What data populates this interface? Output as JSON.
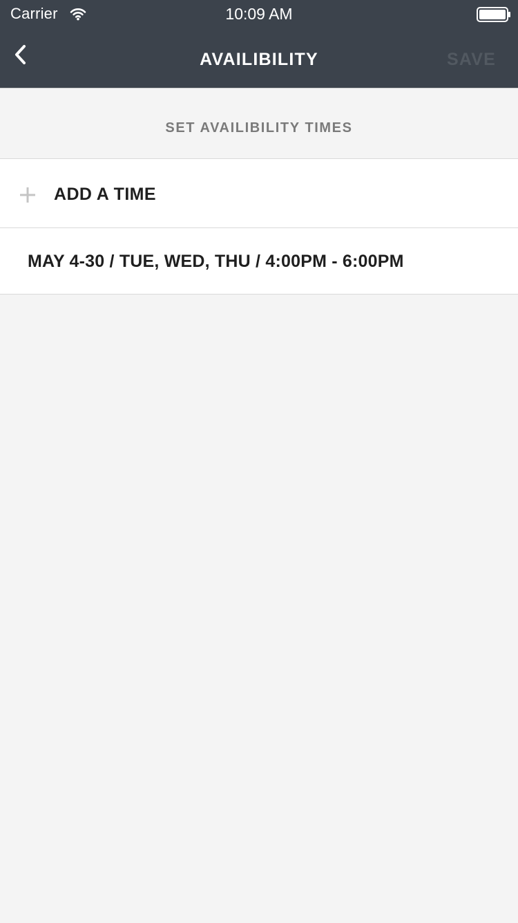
{
  "status_bar": {
    "carrier": "Carrier",
    "time": "10:09 AM",
    "wifi_icon": "wifi-icon",
    "battery_icon": "battery-icon"
  },
  "nav": {
    "back_icon": "chevron-left-icon",
    "title": "AVAILIBILITY",
    "save_label": "SAVE",
    "save_enabled": false
  },
  "section": {
    "title": "SET AVAILIBILITY TIMES"
  },
  "list": {
    "add_icon": "plus-icon",
    "add_label": "ADD A TIME",
    "items": [
      {
        "label": "MAY 4-30 / TUE, WED, THU / 4:00PM - 6:00PM"
      }
    ]
  },
  "colors": {
    "nav_background": "#3c434c",
    "page_background": "#f4f4f4",
    "row_background": "#ffffff",
    "text_primary": "#1f1f1f",
    "text_secondary": "#7a7a7a",
    "save_disabled": "#525961",
    "plus_icon": "#c4c4c4"
  }
}
